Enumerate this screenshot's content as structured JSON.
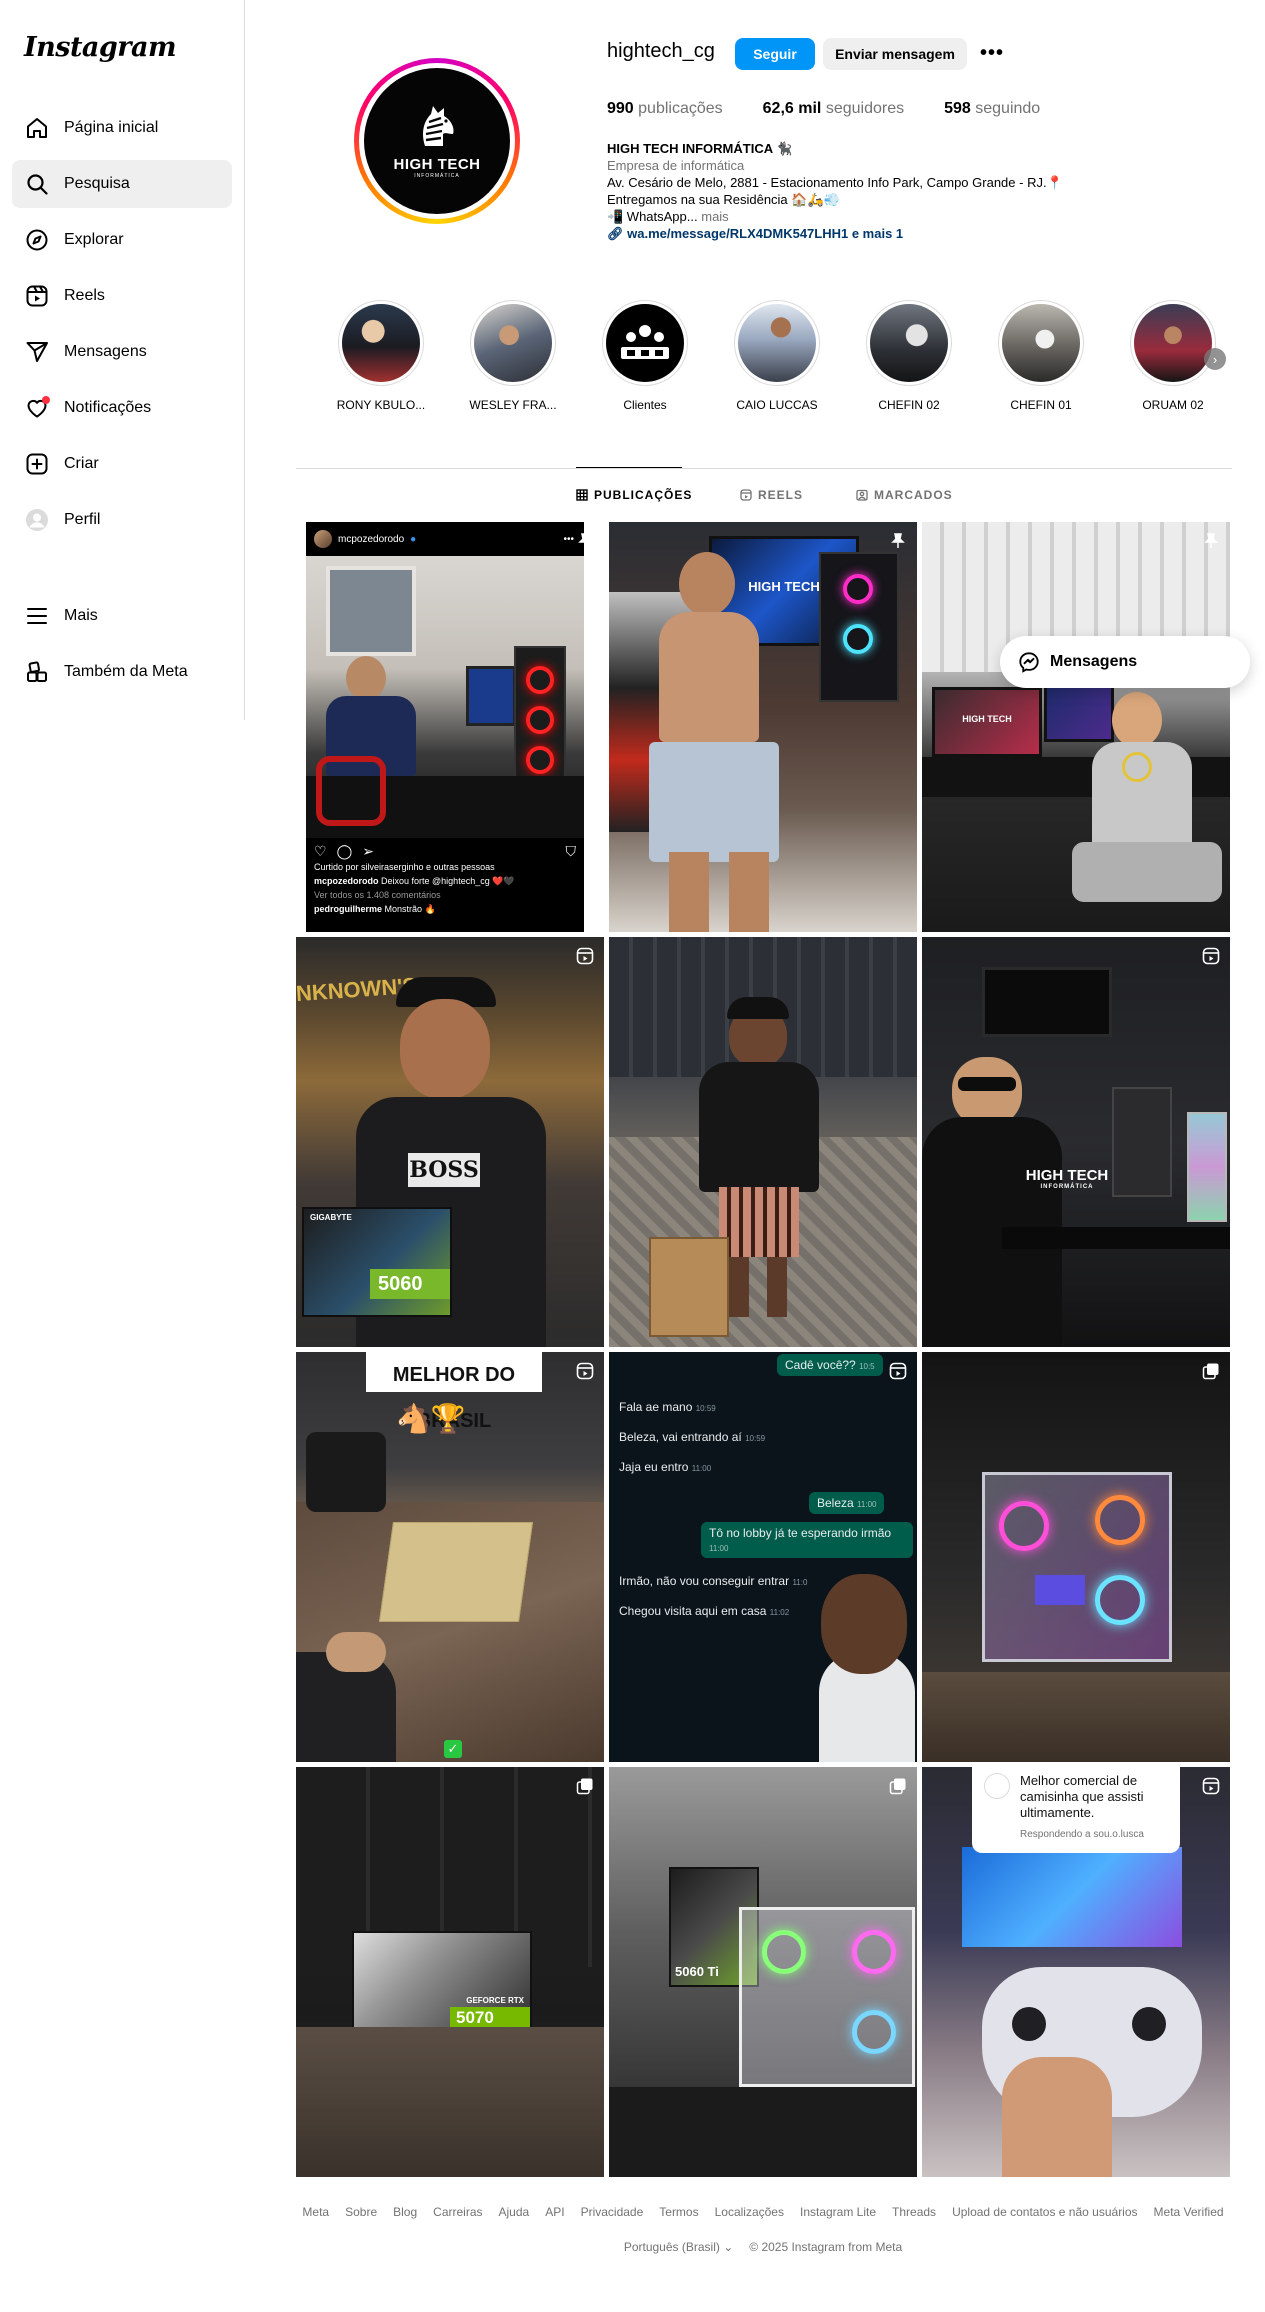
{
  "sidebar": {
    "logo": "Instagram",
    "items": [
      {
        "label": "Página inicial",
        "icon": "home-icon"
      },
      {
        "label": "Pesquisa",
        "icon": "search-icon"
      },
      {
        "label": "Explorar",
        "icon": "compass-icon"
      },
      {
        "label": "Reels",
        "icon": "reels-icon"
      },
      {
        "label": "Mensagens",
        "icon": "send-icon"
      },
      {
        "label": "Notificações",
        "icon": "heart-icon"
      },
      {
        "label": "Criar",
        "icon": "plus-square-icon"
      },
      {
        "label": "Perfil",
        "icon": "avatar-icon"
      },
      {
        "label": "Mais",
        "icon": "menu-icon"
      },
      {
        "label": "Também da Meta",
        "icon": "meta-apps-icon"
      }
    ]
  },
  "profile": {
    "username": "hightech_cg",
    "follow_label": "Seguir",
    "message_label": "Enviar mensagem",
    "avatar_brand": "HIGH TECH",
    "avatar_sub": "INFORMÁTICA",
    "stats": {
      "posts_num": "990",
      "posts_label": "publicações",
      "followers_num": "62,6 mil",
      "followers_label": "seguidores",
      "following_num": "598",
      "following_label": "seguindo"
    },
    "bio": {
      "name": "HIGH TECH INFORMÁTICA 🐈‍⬛",
      "category": "Empresa de informática",
      "line1": "Av. Cesário de Melo, 2881 - Estacionamento Info Park, Campo Grande - RJ.📍",
      "line2": "Entregamos na sua Residência 🏠🛵💨",
      "line3": "📲 WhatsApp...",
      "more": "mais",
      "link": "wa.me/message/RLX4DMK547LHH1 e mais 1"
    }
  },
  "highlights": [
    {
      "label": "RONY KBULO..."
    },
    {
      "label": "WESLEY FRA..."
    },
    {
      "label": "Clientes"
    },
    {
      "label": "CAIO LUCCAS"
    },
    {
      "label": "CHEFIN 02"
    },
    {
      "label": "CHEFIN 01"
    },
    {
      "label": "ORUAM 02"
    }
  ],
  "tabs": [
    {
      "label": "PUBLICAÇÕES",
      "icon": "grid-icon"
    },
    {
      "label": "REELS",
      "icon": "reels-icon"
    },
    {
      "label": "MARCADOS",
      "icon": "tagged-icon"
    }
  ],
  "posts": {
    "p1": {
      "handle": "mcpozedorodo",
      "liked": "Curtido por silveiraserginho e outras pessoas",
      "caption_user": "mcpozedorodo",
      "caption": "Deixou forte @hightech_cg ❤️🖤",
      "comments": "Ver todos os 1.408 comentários",
      "comment_user": "pedroguilherme",
      "comment": "Monstrão 🔥"
    },
    "p2_text": "HIGH TECH",
    "p3_text": "HIGH TECH",
    "p4_shirt": "BOSS",
    "p4_gpu_brand": "GIGABYTE",
    "p4_gpu_model": "5060",
    "p4_banner": "NKNOWN'S",
    "p6_logo": "HIGH TECH",
    "p6_logo_sub": "INFORMÁTICA",
    "p7_banner": "MELHOR DO BRASIL",
    "p7_emoji": "🐴🏆",
    "p8_chat": [
      {
        "text": "Cadê você??",
        "time": "10:5",
        "out": true
      },
      {
        "text": "Fala ae mano",
        "time": "10:59",
        "out": false
      },
      {
        "text": "Beleza, vai entrando aí",
        "time": "10:59",
        "out": false
      },
      {
        "text": "Jaja eu entro",
        "time": "11:00",
        "out": false
      },
      {
        "text": "Beleza",
        "time": "11:00",
        "out": true
      },
      {
        "text": "Tô no lobby já te esperando irmão",
        "time": "11:00",
        "out": true
      },
      {
        "text": "Irmão, não vou conseguir entrar",
        "time": "11:0",
        "out": false
      },
      {
        "text": "Chegou visita aqui em casa",
        "time": "11:02",
        "out": false
      }
    ],
    "p10_gpu": "5070",
    "p10_gpu_brand": "GEFORCE RTX",
    "p11_gpu": "5060 Ti",
    "p12_caption": "Melhor comercial de camisinha que assisti ultimamente.",
    "p12_reply": "Respondendo a sou.o.lusca"
  },
  "floating_messages": {
    "label": "Mensagens"
  },
  "footer": {
    "links": [
      "Meta",
      "Sobre",
      "Blog",
      "Carreiras",
      "Ajuda",
      "API",
      "Privacidade",
      "Termos",
      "Localizações",
      "Instagram Lite",
      "Threads",
      "Upload de contatos e não usuários",
      "Meta Verified"
    ],
    "language": "Português (Brasil) ⌄",
    "copyright": "© 2025 Instagram from Meta"
  }
}
